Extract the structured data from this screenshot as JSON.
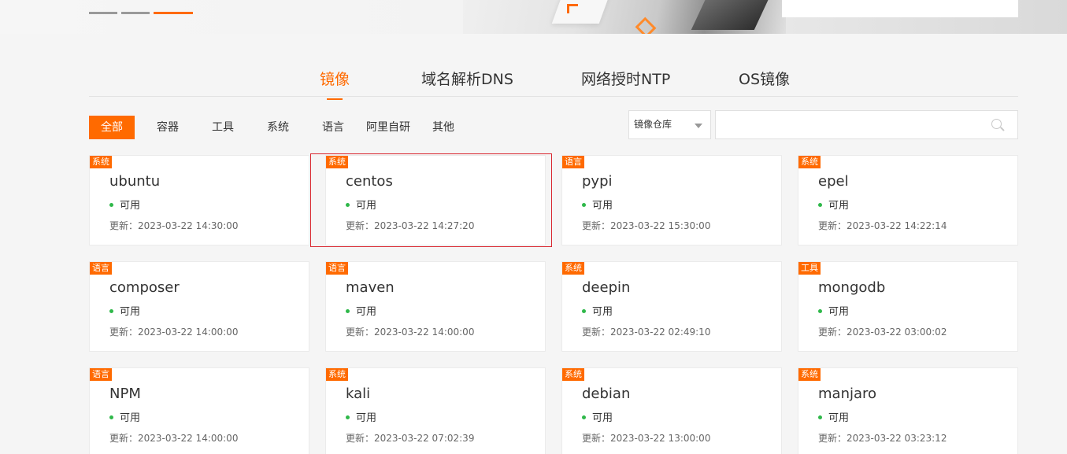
{
  "colors": {
    "accent": "#ff6a00",
    "status_ok": "#2fb84a",
    "highlight": "#d9262e"
  },
  "tabs": [
    {
      "label": "镜像",
      "active": true
    },
    {
      "label": "域名解析DNS",
      "active": false
    },
    {
      "label": "网络授时NTP",
      "active": false
    },
    {
      "label": "OS镜像",
      "active": false
    }
  ],
  "filters": [
    {
      "label": "全部",
      "active": true
    },
    {
      "label": "容器",
      "active": false
    },
    {
      "label": "工具",
      "active": false
    },
    {
      "label": "系统",
      "active": false
    },
    {
      "label": "语言",
      "active": false
    },
    {
      "label": "阿里自研",
      "active": false
    },
    {
      "label": "其他",
      "active": false
    }
  ],
  "search": {
    "select_value": "镜像仓库",
    "input_value": "",
    "icon": "search-icon"
  },
  "status_label": "可用",
  "cards": [
    {
      "tag": "系统",
      "name": "ubuntu",
      "updated": "更新：2023-03-22 14:30:00"
    },
    {
      "tag": "系统",
      "name": "centos",
      "updated": "更新：2023-03-22 14:27:20"
    },
    {
      "tag": "语言",
      "name": "pypi",
      "updated": "更新：2023-03-22 15:30:00"
    },
    {
      "tag": "系统",
      "name": "epel",
      "updated": "更新：2023-03-22 14:22:14"
    },
    {
      "tag": "语言",
      "name": "composer",
      "updated": "更新：2023-03-22 14:00:00"
    },
    {
      "tag": "语言",
      "name": "maven",
      "updated": "更新：2023-03-22 14:00:00"
    },
    {
      "tag": "系统",
      "name": "deepin",
      "updated": "更新：2023-03-22 02:49:10"
    },
    {
      "tag": "工具",
      "name": "mongodb",
      "updated": "更新：2023-03-22 03:00:02"
    },
    {
      "tag": "语言",
      "name": "NPM",
      "updated": "更新：2023-03-22 14:00:00"
    },
    {
      "tag": "系统",
      "name": "kali",
      "updated": "更新：2023-03-22 07:02:39"
    },
    {
      "tag": "系统",
      "name": "debian",
      "updated": "更新：2023-03-22 13:00:00"
    },
    {
      "tag": "系统",
      "name": "manjaro",
      "updated": "更新：2023-03-22 03:23:12"
    }
  ]
}
